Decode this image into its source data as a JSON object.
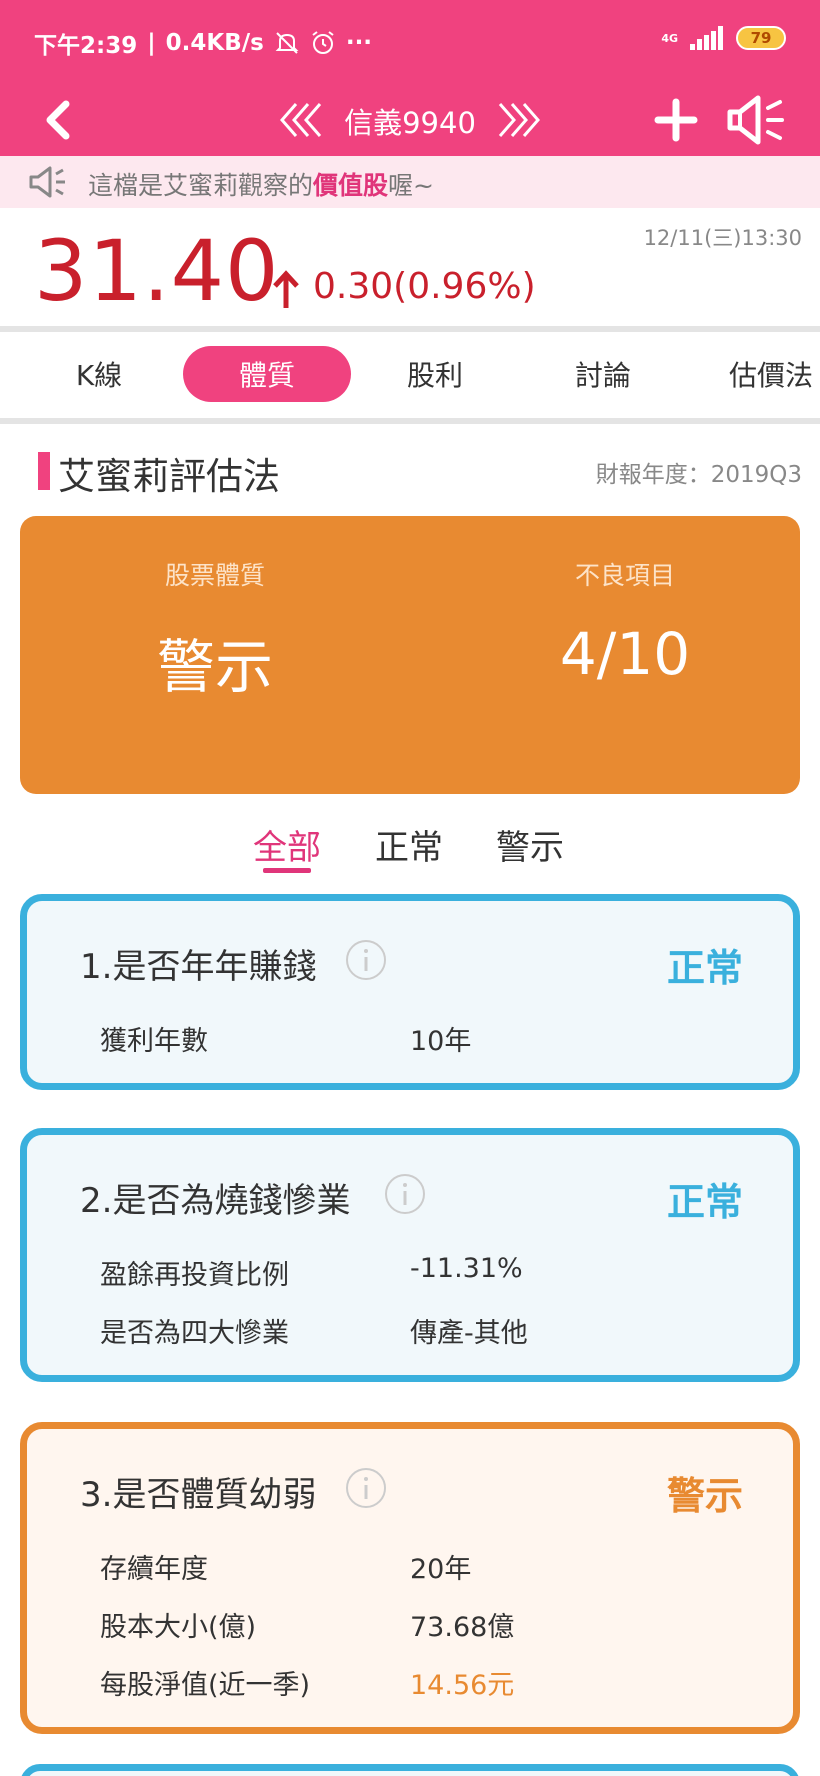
{
  "status_bar": {
    "time": "下午2:39",
    "net_speed": "0.4KB/s",
    "more": "···",
    "network": "4G",
    "battery": "79",
    "icons": [
      "mute-bell-icon",
      "alarm-icon",
      "signal-icon",
      "battery-icon"
    ]
  },
  "nav": {
    "title": "信義9940",
    "icons": [
      "back-icon",
      "prev-stock-icon",
      "next-stock-icon",
      "add-icon",
      "speaker-icon"
    ]
  },
  "marquee": {
    "text_before": "這檔是艾蜜莉觀察的",
    "highlight": "價值股",
    "text_after": "喔~"
  },
  "quote": {
    "price": "31.40",
    "change": "0.30(0.96%)",
    "datetime": "12/11(三)13:30"
  },
  "tabs": [
    {
      "label": "K線",
      "active": false
    },
    {
      "label": "體質",
      "active": true
    },
    {
      "label": "股利",
      "active": false
    },
    {
      "label": "討論",
      "active": false
    },
    {
      "label": "估價法",
      "active": false
    }
  ],
  "section": {
    "title": "艾蜜莉評估法",
    "report_year": "財報年度：2019Q3"
  },
  "summary": {
    "quality_label": "股票體質",
    "quality_value": "警示",
    "bad_label": "不良項目",
    "bad_value": "4/10"
  },
  "filter_tabs": [
    {
      "label": "全部",
      "active": true
    },
    {
      "label": "正常",
      "active": false
    },
    {
      "label": "警示",
      "active": false
    }
  ],
  "items": [
    {
      "title": "1.是否年年賺錢",
      "status": "正常",
      "rows": [
        {
          "label": "獲利年數",
          "value": "10年"
        }
      ]
    },
    {
      "title": "2.是否為燒錢慘業",
      "status": "正常",
      "rows": [
        {
          "label": "盈餘再投資比例",
          "value": "-11.31%"
        },
        {
          "label": "是否為四大慘業",
          "value": "傳產-其他"
        }
      ]
    },
    {
      "title": "3.是否體質幼弱",
      "status": "警示",
      "rows": [
        {
          "label": "存續年度",
          "value": "20年"
        },
        {
          "label": "股本大小(億)",
          "value": "73.68億"
        },
        {
          "label": "每股淨值(近一季)",
          "value": "14.56元"
        }
      ]
    }
  ],
  "colors": {
    "brand_pink": "#f0427f",
    "price_red": "#c9202c",
    "warning_orange": "#e88a31",
    "normal_blue": "#3ab0dd"
  }
}
